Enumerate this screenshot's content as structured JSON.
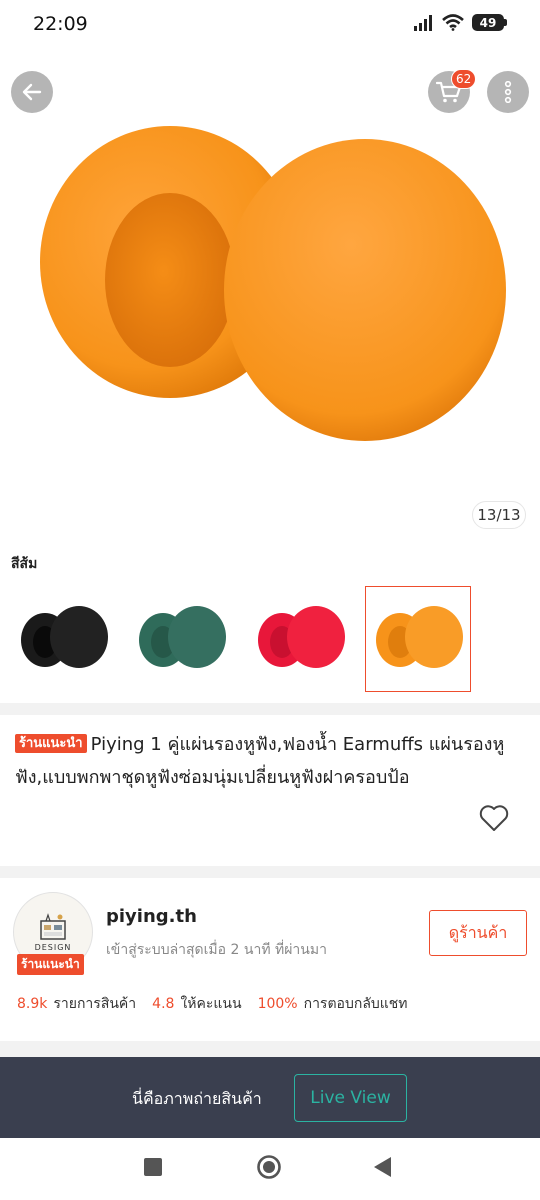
{
  "status_bar": {
    "time": "22:09",
    "battery": "49"
  },
  "hero": {
    "counter": "13/13",
    "cart_count": "62"
  },
  "variants": {
    "label": "สีส้ม",
    "items": [
      {
        "color": "#1a1a1a",
        "name": "black"
      },
      {
        "color": "#2f6b5a",
        "name": "green"
      },
      {
        "color": "#e8173a",
        "name": "red"
      },
      {
        "color": "#f7931a",
        "name": "orange",
        "selected": true
      }
    ]
  },
  "product": {
    "tag": "ร้านแนะนำ",
    "title": "Piying 1 คู่แผ่นรองหูฟัง,ฟองน้ำ Earmuffs แผ่นรองหูฟัง,แบบพกพาชุดหูฟังซ่อมนุ่มเปลี่ยนหูฟังฝาครอบป้อ"
  },
  "shop": {
    "logo_text": "DESIGN",
    "tag": "ร้านแนะนำ",
    "name": "piying.th",
    "active": "เข้าสู่ระบบล่าสุดเมื่อ 2 นาที ที่ผ่านมา",
    "view_button": "ดูร้านค้า",
    "stats": [
      {
        "value": "8.9k",
        "label": "รายการสินค้า"
      },
      {
        "value": "4.8",
        "label": "ให้คะแนน"
      },
      {
        "value": "100%",
        "label": "การตอบกลับแชท"
      }
    ]
  },
  "live_banner": {
    "text": "นี่คือภาพถ่ายสินค้า",
    "button": "Live View"
  },
  "colors": {
    "accent": "#ee4d2d",
    "teal": "#2bb3a2",
    "banner": "#3a3f4f"
  }
}
